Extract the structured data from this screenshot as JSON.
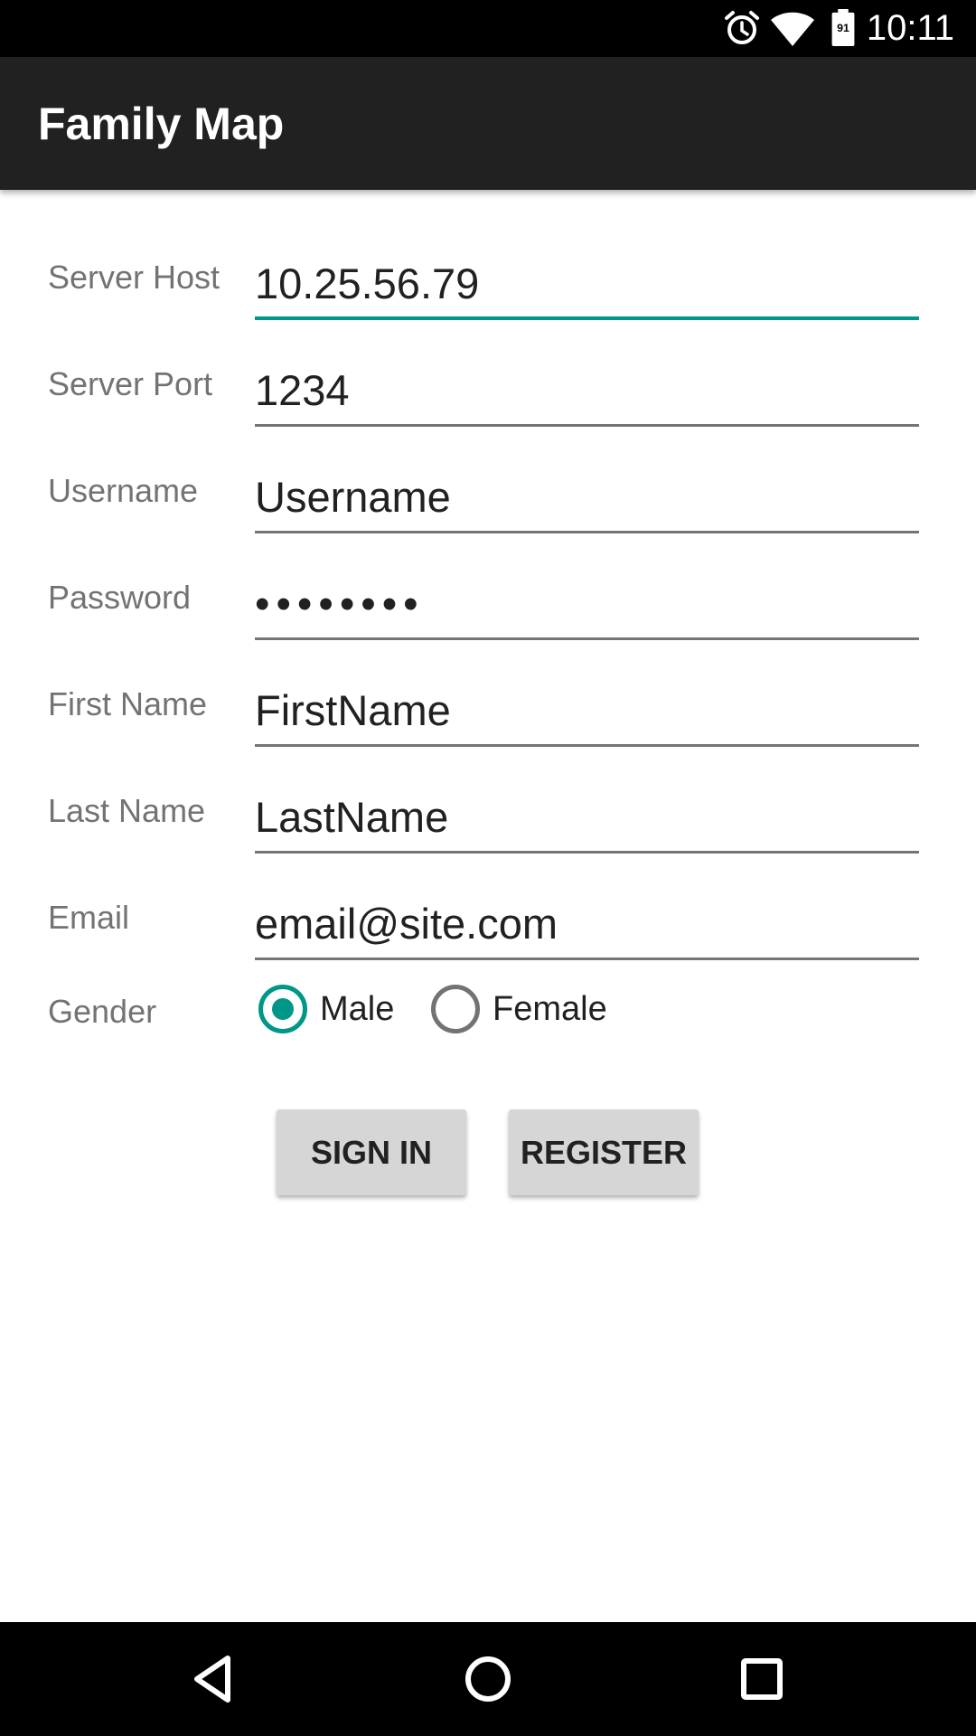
{
  "status_bar": {
    "time": "10:11",
    "battery_level": "91",
    "icons": [
      "alarm-icon",
      "wifi-icon",
      "battery-icon"
    ]
  },
  "app_bar": {
    "title": "Family Map"
  },
  "form": {
    "fields": [
      {
        "label": "Server Host",
        "value": "10.25.56.79",
        "focused": true
      },
      {
        "label": "Server Port",
        "value": "1234"
      },
      {
        "label": "Username",
        "value": "Username"
      },
      {
        "label": "Password",
        "value": "••••••••"
      },
      {
        "label": "First Name",
        "value": "FirstName"
      },
      {
        "label": "Last Name",
        "value": "LastName"
      },
      {
        "label": "Email",
        "value": "email@site.com"
      }
    ],
    "gender": {
      "label": "Gender",
      "options": [
        {
          "label": "Male",
          "selected": true
        },
        {
          "label": "Female",
          "selected": false
        }
      ]
    }
  },
  "buttons": {
    "sign_in": "SIGN IN",
    "register": "REGISTER"
  },
  "nav_bar": {
    "icons": [
      "back-icon",
      "home-icon",
      "recents-icon"
    ]
  },
  "colors": {
    "accent": "#009688",
    "app_bar": "#212121",
    "button_bg": "#d6d6d6",
    "label_text": "#737373"
  }
}
